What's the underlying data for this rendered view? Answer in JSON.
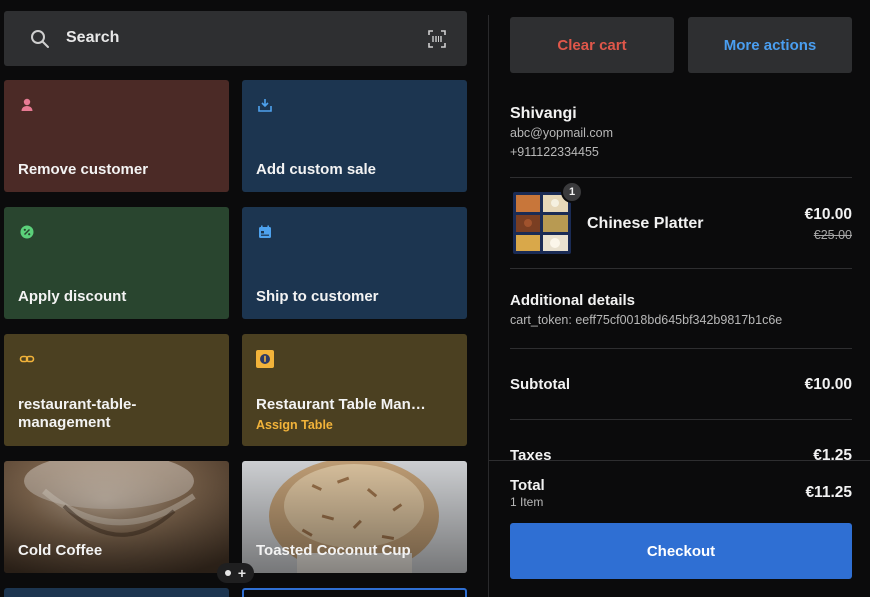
{
  "search": {
    "label": "Search"
  },
  "tiles": [
    {
      "label": "Remove customer",
      "icon": "person-icon",
      "color": "#4b2a26",
      "icon_color": "#e77a93"
    },
    {
      "label": "Add custom sale",
      "icon": "tray-plus-icon",
      "color": "#1c3550",
      "icon_color": "#4ea2ee"
    },
    {
      "label": "Apply discount",
      "icon": "discount-badge-icon",
      "color": "#29452f",
      "icon_color": "#5bd07a"
    },
    {
      "label": "Ship to customer",
      "icon": "calendar-truck-icon",
      "color": "#1c3550",
      "icon_color": "#4ea2ee"
    },
    {
      "label": "restaurant-table-management",
      "icon": "link-icon",
      "color": "#4b4021",
      "icon_color": "#f2b33a"
    },
    {
      "label": "Restaurant Table Man…",
      "sublabel": "Assign Table",
      "icon": "app-badge-icon",
      "color": "#4b4021",
      "icon_color": "#f2b33a"
    },
    {
      "label": "Cold Coffee",
      "image": "cold-coffee-photo"
    },
    {
      "label": "Toasted Coconut Cup",
      "image": "coconut-cup-photo"
    }
  ],
  "actions": {
    "clear_cart": "Clear cart",
    "more_actions": "More actions"
  },
  "customer": {
    "name": "Shivangi",
    "email": "abc@yopmail.com",
    "phone": "+911122334455"
  },
  "cart": {
    "items": [
      {
        "name": "Chinese Platter",
        "qty": "1",
        "price": "€10.00",
        "original_price": "€25.00"
      }
    ]
  },
  "additional": {
    "title": "Additional details",
    "token": "cart_token: eeff75cf0018bd645bf342b9817b1c6e"
  },
  "summary": {
    "subtotal_label": "Subtotal",
    "subtotal": "€10.00",
    "taxes_label": "Taxes",
    "taxes": "€1.25",
    "total_label": "Total",
    "total_items": "1 Item",
    "total": "€11.25"
  },
  "checkout_label": "Checkout",
  "colors": {
    "accent_blue": "#2f6fd3",
    "danger": "#e0574a",
    "link_blue": "#4a9ef0"
  }
}
